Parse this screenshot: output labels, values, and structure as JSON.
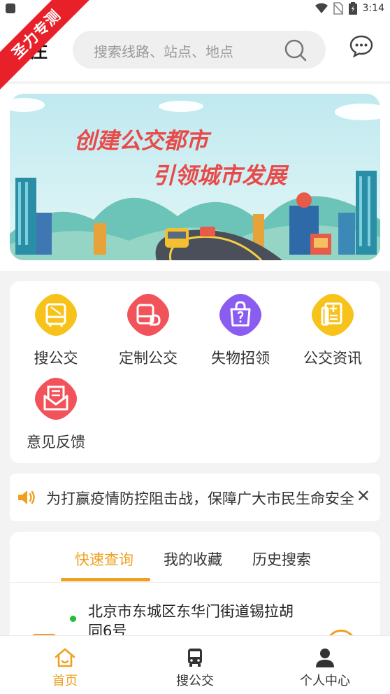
{
  "status_bar": {
    "time": "3:14"
  },
  "ribbon": {
    "text": "圣力专测"
  },
  "header": {
    "city_label": "枣庄",
    "search_placeholder": "搜索线路、站点、地点"
  },
  "banner": {
    "line1": "创建公交都市",
    "line2": "引领城市发展"
  },
  "grid_menu": {
    "items": [
      {
        "label": "搜公交",
        "icon": "bus-icon",
        "color": "#f7c21a"
      },
      {
        "label": "定制公交",
        "icon": "custom-bus-icon",
        "color": "#f2535a"
      },
      {
        "label": "失物招领",
        "icon": "shopping-bag-icon",
        "color": "#8a5cf0"
      },
      {
        "label": "公交资讯",
        "icon": "news-icon",
        "color": "#f7c21a"
      },
      {
        "label": "意见反馈",
        "icon": "mail-icon",
        "color": "#f2535a"
      }
    ]
  },
  "notice": {
    "text": "为打赢疫情防控阻击战，保障广大市民生命安全"
  },
  "tabs": {
    "items": [
      "快速查询",
      "我的收藏",
      "历史搜索"
    ],
    "active": "快速查询"
  },
  "quick_query": {
    "address": "北京市东城区东华门街道锡拉胡同6号"
  },
  "bottom_nav": {
    "items": [
      {
        "label": "首页",
        "icon": "home-icon"
      },
      {
        "label": "搜公交",
        "icon": "bus-icon"
      },
      {
        "label": "个人中心",
        "icon": "person-icon"
      }
    ],
    "active": "首页"
  },
  "colors": {
    "accent": "#f0a020",
    "ribbon": "#e8202a",
    "status_green": "#1fbf3a"
  }
}
